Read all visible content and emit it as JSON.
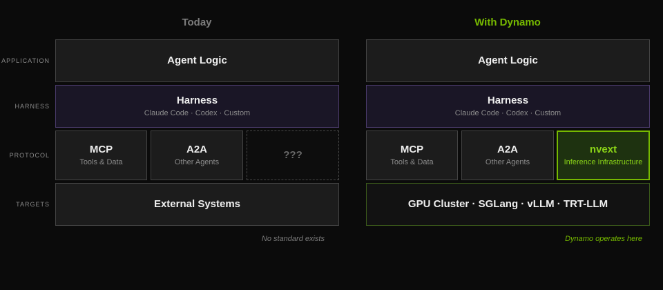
{
  "columns": {
    "today": {
      "title": "Today",
      "note": "No standard exists",
      "application": {
        "label": "Agent Logic"
      },
      "harness": {
        "label": "Harness",
        "sub": "Claude Code · Codex · Custom"
      },
      "protocol": [
        {
          "label": "MCP",
          "sub": "Tools & Data"
        },
        {
          "label": "A2A",
          "sub": "Other Agents"
        },
        {
          "label": "???",
          "sub": ""
        }
      ],
      "targets": {
        "label": "External Systems"
      }
    },
    "dynamo": {
      "title": "With Dynamo",
      "note": "Dynamo operates here",
      "application": {
        "label": "Agent Logic"
      },
      "harness": {
        "label": "Harness",
        "sub": "Claude Code · Codex · Custom"
      },
      "protocol": [
        {
          "label": "MCP",
          "sub": "Tools & Data"
        },
        {
          "label": "A2A",
          "sub": "Other Agents"
        },
        {
          "label": "nvext",
          "sub": "Inference Infrastructure"
        }
      ],
      "targets": {
        "label": "GPU Cluster · SGLang · vLLM · TRT-LLM"
      }
    }
  },
  "row_labels": {
    "application": "APPLICATION",
    "harness": "HARNESS",
    "protocol": "PROTOCOL",
    "targets": "TARGETS"
  },
  "colors": {
    "accent_green": "#76b900",
    "harness_bg": "#1a1626",
    "harness_border": "#4a3a6a",
    "background": "#0b0b0b"
  }
}
